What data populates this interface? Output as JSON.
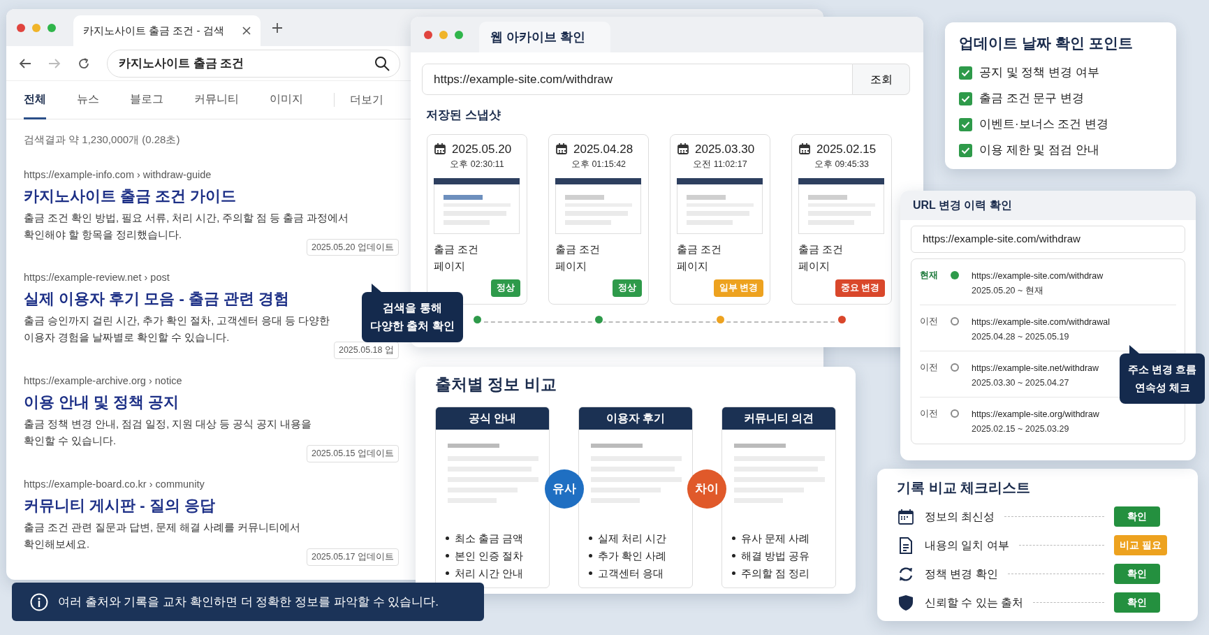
{
  "search_window": {
    "tab_title": "카지노사이트 출금 조건 - 검색",
    "forward_enabled": false,
    "query": "카지노사이트 출금 조건",
    "tabs": [
      {
        "label": "전체",
        "selected": true
      },
      {
        "label": "뉴스",
        "selected": false
      },
      {
        "label": "블로그",
        "selected": false
      },
      {
        "label": "커뮤니티",
        "selected": false
      },
      {
        "label": "이미지",
        "selected": false
      },
      {
        "label": "더보기",
        "selected": false
      }
    ],
    "result_count": "검색결과 약 1,230,000개 (0.28초)",
    "results": [
      {
        "url": "https://example-info.com › withdraw-guide",
        "title": "카지노사이트 출금 조건 가이드",
        "description": "출금 조건 확인 방법, 필요 서류, 처리 시간, 주의할 점 등 출금 과정에서\n확인해야 할 항목을 정리했습니다.",
        "updated": "2025.05.20 업데이트"
      },
      {
        "url": "https://example-review.net › post",
        "title": "실제 이용자 후기 모음 - 출금 관련 경험",
        "description": "출금 승인까지 걸린 시간, 추가 확인 절차, 고객센터 응대 등 다양한\n이용자 경험을 날짜별로 확인할 수 있습니다.",
        "updated": "2025.05.18 업"
      },
      {
        "url": "https://example-archive.org › notice",
        "title": "이용 안내 및 정책 공지",
        "description": "출금 정책 변경 안내, 점검 일정, 지원 대상 등 공식 공지 내용을\n확인할 수 있습니다.",
        "updated": "2025.05.15 업데이트"
      },
      {
        "url": "https://example-board.co.kr › community",
        "title": "커뮤니티 게시판 - 질의 응답",
        "description": "출금 조건 관련 질문과 답변, 문제 해결 사례를 커뮤니티에서\n확인해보세요.",
        "updated": "2025.05.17 업데이트"
      }
    ]
  },
  "search_tooltip": "검색을 통해\n다양한 출처 확인",
  "archive_window": {
    "title": "웹 아카이브 확인",
    "url": "https://example-site.com/withdraw",
    "lookup_button": "조회",
    "section_title": "저장된 스냅샷",
    "snapshots": [
      {
        "date": "2025.05.20",
        "time": "오후 02:30:11",
        "label": "출금 조건\n페이지",
        "status": "정상",
        "color": "#2e9a4a",
        "highlighted": true
      },
      {
        "date": "2025.04.28",
        "time": "오후 01:15:42",
        "label": "출금 조건\n페이지",
        "status": "정상",
        "color": "#2e9a4a",
        "highlighted": false
      },
      {
        "date": "2025.03.30",
        "time": "오전 11:02:17",
        "label": "출금 조건\n페이지",
        "status": "일부 변경",
        "color": "#eda21f",
        "highlighted": false
      },
      {
        "date": "2025.02.15",
        "time": "오후 09:45:33",
        "label": "출금 조건\n페이지",
        "status": "중요 변경",
        "color": "#d9472b",
        "highlighted": false
      }
    ]
  },
  "comparison": {
    "title": "출처별 정보 비교",
    "columns": [
      {
        "header": "공식 안내",
        "bullets": [
          "최소 출금 금액",
          "본인 인증 절차",
          "처리 시간 안내"
        ]
      },
      {
        "header": "이용자 후기",
        "bullets": [
          "실제 처리 시간",
          "추가 확인 사례",
          "고객센터 응대"
        ]
      },
      {
        "header": "커뮤니티 의견",
        "bullets": [
          "유사 문제 사례",
          "해결 방법 공유",
          "주의할 점 정리"
        ]
      }
    ],
    "connectors": [
      {
        "label": "유사",
        "color": "#1f6fc2"
      },
      {
        "label": "차이",
        "color": "#e0592a"
      }
    ]
  },
  "info_banner": "여러 출처와 기록을 교차 확인하면 더 정확한 정보를 파악할 수 있습니다.",
  "update_points": {
    "title": "업데이트 날짜 확인 포인트",
    "items": [
      {
        "label": "공지 및 정책 변경 여부",
        "checked": true
      },
      {
        "label": "출금 조건 문구 변경",
        "checked": true
      },
      {
        "label": "이벤트·보너스 조건 변경",
        "checked": true
      },
      {
        "label": "이용 제한 및 점검 안내",
        "checked": true
      }
    ]
  },
  "url_history": {
    "title": "URL 변경 이력 확인",
    "url": "https://example-site.com/withdraw",
    "entries": [
      {
        "label": "현재",
        "current": true,
        "url": "https://example-site.com/withdraw",
        "period": "2025.05.20 ~ 현재"
      },
      {
        "label": "이전",
        "current": false,
        "url": "https://example-site.com/withdrawal",
        "period": "2025.04.28 ~ 2025.05.19"
      },
      {
        "label": "이전",
        "current": false,
        "url": "https://example-site.net/withdraw",
        "period": "2025.03.30 ~ 2025.04.27"
      },
      {
        "label": "이전",
        "current": false,
        "url": "https://example-site.org/withdraw",
        "period": "2025.02.15 ~ 2025.03.29"
      }
    ],
    "tooltip": "주소 변경 흐름\n연속성 체크"
  },
  "checklist": {
    "title": "기록 비교 체크리스트",
    "items": [
      {
        "kind": "calendar",
        "label": "정보의 최신성",
        "status": "확인",
        "color": "#24903f"
      },
      {
        "kind": "document",
        "label": "내용의 일치 여부",
        "status": "비교 필요",
        "color": "#eda21f"
      },
      {
        "kind": "refresh",
        "label": "정책 변경 확인",
        "status": "확인",
        "color": "#24903f"
      },
      {
        "kind": "shield",
        "label": "신뢰할 수 있는 출처",
        "status": "확인",
        "color": "#24903f"
      }
    ]
  }
}
